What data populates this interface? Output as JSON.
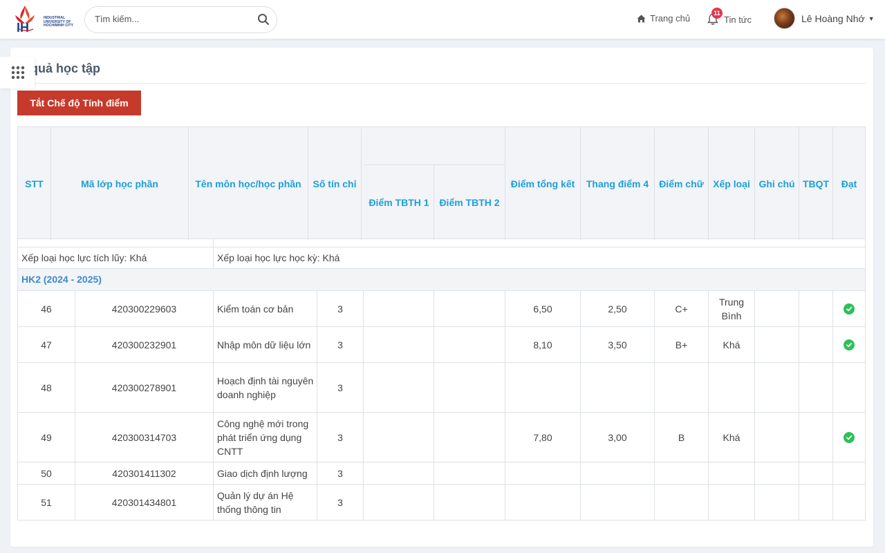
{
  "header": {
    "logo_abbr": "IUH",
    "logo_text": [
      "INDUSTRIAL",
      "UNIVERSITY OF",
      "HOCHIMINH CITY"
    ],
    "search_placeholder": "Tìm kiếm...",
    "nav_home": "Trang chủ",
    "nav_news": "Tin tức",
    "news_badge": "11",
    "user_name": "Lê Hoàng Nhớ"
  },
  "page": {
    "title": "t quả học tập",
    "toggle_button": "Tắt Chế độ Tính điểm"
  },
  "table": {
    "columns": {
      "stt": "STT",
      "ma_lop": "Mã lớp học phần",
      "ten_mon": "Tên môn học/học phần",
      "so_tin_chi": "Số tín chỉ",
      "tbth1": "Điểm TBTH 1",
      "tbth2": "Điểm TBTH 2",
      "tong_ket": "Điểm tổng kết",
      "thang4": "Thang điểm 4",
      "diem_chu": "Điểm chữ",
      "xep_loai": "Xếp loại",
      "ghi_chu": "Ghi chú",
      "tbqt": "TBQT",
      "dat": "Đạt"
    },
    "summary": {
      "tich_luy": "Xếp loại học lực tích lũy: Khá",
      "hoc_ky": "Xếp loại học lực học kỳ: Khá"
    },
    "semester_label": "HK2 (2024 - 2025)",
    "rows": [
      {
        "stt": "46",
        "ma": "420300229603",
        "ten": "Kiểm toán cơ bản",
        "tc": "3",
        "tbth1": "",
        "tbth2": "",
        "tk": "6,50",
        "t4": "2,50",
        "chu": "C+",
        "xl": "Trung Bình",
        "gc": "",
        "tbqt": "",
        "dat": true
      },
      {
        "stt": "47",
        "ma": "420300232901",
        "ten": "Nhập môn dữ liệu lớn",
        "tc": "3",
        "tbth1": "",
        "tbth2": "",
        "tk": "8,10",
        "t4": "3,50",
        "chu": "B+",
        "xl": "Khá",
        "gc": "",
        "tbqt": "",
        "dat": true
      },
      {
        "stt": "48",
        "ma": "420300278901",
        "ten": "Hoạch định tài nguyên doanh nghiệp",
        "tc": "3",
        "tbth1": "",
        "tbth2": "",
        "tk": "",
        "t4": "",
        "chu": "",
        "xl": "",
        "gc": "",
        "tbqt": "",
        "dat": false
      },
      {
        "stt": "49",
        "ma": "420300314703",
        "ten": "Công nghệ mới trong phát triển ứng dụng CNTT",
        "tc": "3",
        "tbth1": "",
        "tbth2": "",
        "tk": "7,80",
        "t4": "3,00",
        "chu": "B",
        "xl": "Khá",
        "gc": "",
        "tbqt": "",
        "dat": true
      },
      {
        "stt": "50",
        "ma": "420301411302",
        "ten": "Giao dịch định lượng",
        "tc": "3",
        "tbth1": "",
        "tbth2": "",
        "tk": "",
        "t4": "",
        "chu": "",
        "xl": "",
        "gc": "",
        "tbqt": "",
        "dat": false
      },
      {
        "stt": "51",
        "ma": "420301434801",
        "ten": "Quản lý dự án Hệ thống thông tin",
        "tc": "3",
        "tbth1": "",
        "tbth2": "",
        "tk": "",
        "t4": "",
        "chu": "",
        "xl": "",
        "gc": "",
        "tbqt": "",
        "dat": false
      }
    ]
  },
  "colors": {
    "header_text": "#1b9fdb",
    "semester_text": "#3d8ad0",
    "button_bg": "#c63a2b",
    "check_green": "#2ec05a",
    "badge_red": "#e8344e"
  }
}
